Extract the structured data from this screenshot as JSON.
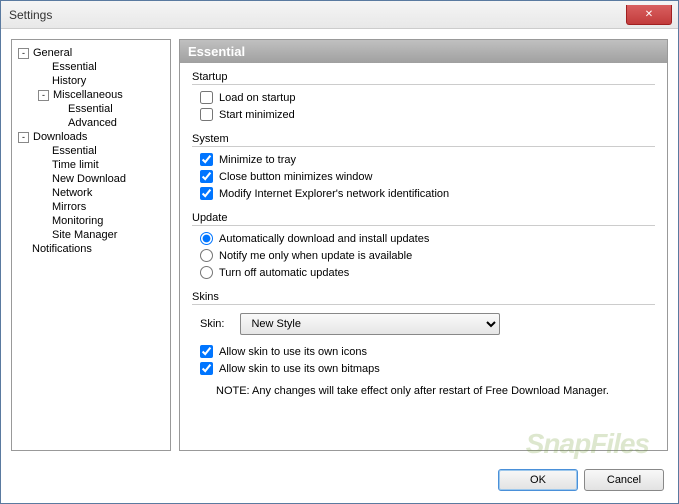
{
  "window": {
    "title": "Settings"
  },
  "tree": {
    "items": [
      {
        "level": 0,
        "label": "General",
        "expand": "-"
      },
      {
        "level": 1,
        "label": "Essential"
      },
      {
        "level": 1,
        "label": "History"
      },
      {
        "level": 1,
        "label": "Miscellaneous",
        "expand": "-"
      },
      {
        "level": 2,
        "label": "Essential"
      },
      {
        "level": 2,
        "label": "Advanced"
      },
      {
        "level": 0,
        "label": "Downloads",
        "expand": "-"
      },
      {
        "level": 1,
        "label": "Essential"
      },
      {
        "level": 1,
        "label": "Time limit"
      },
      {
        "level": 1,
        "label": "New Download"
      },
      {
        "level": 1,
        "label": "Network"
      },
      {
        "level": 1,
        "label": "Mirrors"
      },
      {
        "level": 1,
        "label": "Monitoring"
      },
      {
        "level": 1,
        "label": "Site Manager"
      },
      {
        "level": 0,
        "label": "Notifications"
      }
    ]
  },
  "panel": {
    "header": "Essential",
    "sections": {
      "startup": {
        "title": "Startup",
        "load_on_startup": "Load on startup",
        "start_minimized": "Start minimized"
      },
      "system": {
        "title": "System",
        "minimize_to_tray": "Minimize to tray",
        "close_minimizes": "Close button minimizes window",
        "modify_ie": "Modify Internet Explorer's network identification"
      },
      "update": {
        "title": "Update",
        "auto": "Automatically download and install updates",
        "notify": "Notify me only when update is available",
        "off": "Turn off automatic updates"
      },
      "skins": {
        "title": "Skins",
        "skin_label": "Skin:",
        "skin_value": "New Style",
        "allow_icons": "Allow skin to use its own icons",
        "allow_bitmaps": "Allow skin to use its own bitmaps",
        "note": "NOTE: Any changes will take effect only after restart of Free Download Manager."
      }
    }
  },
  "buttons": {
    "ok": "OK",
    "cancel": "Cancel"
  },
  "watermark": "SnapFiles"
}
